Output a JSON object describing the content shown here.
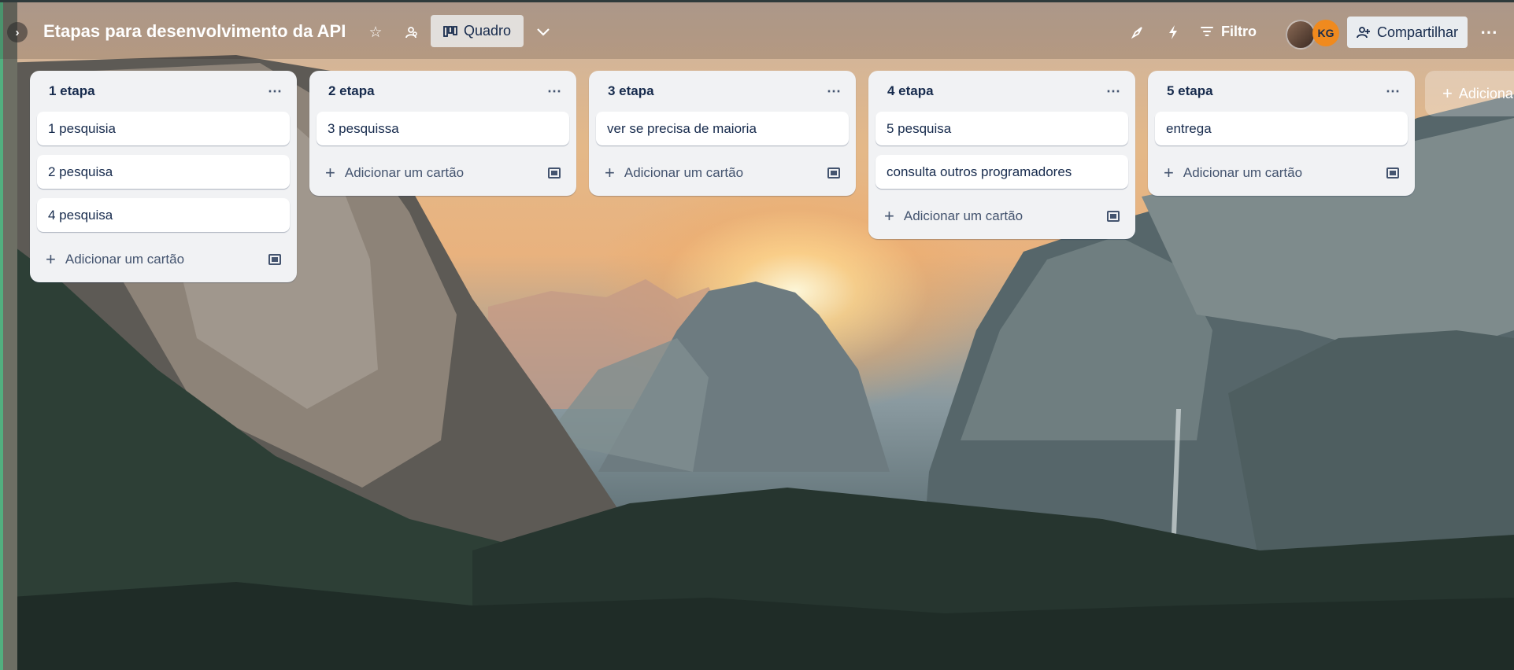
{
  "board": {
    "title": "Etapas para desenvolvimento da API",
    "view_label": "Quadro",
    "filter_label": "Filtro",
    "share_label": "Compartilhar",
    "member_initials": "KG"
  },
  "lists": [
    {
      "title": "1 etapa",
      "cards": [
        "1 pesquisia",
        "2 pesquisa",
        "4 pesquisa"
      ]
    },
    {
      "title": "2 etapa",
      "cards": [
        "3 pesquissa"
      ]
    },
    {
      "title": "3 etapa",
      "cards": [
        "ver se precisa de maioria"
      ]
    },
    {
      "title": "4 etapa",
      "cards": [
        "5 pesquisa",
        "consulta outros programadores"
      ]
    },
    {
      "title": "5 etapa",
      "cards": [
        "entrega"
      ]
    }
  ],
  "add_card_label": "Adicionar um cartão",
  "add_list_label": "Adiciona",
  "icons": {
    "expand": "chevron-right-icon",
    "star": "star-icon",
    "visibility": "workspace-visibility-icon",
    "view": "board-view-icon",
    "view_switch": "chevron-down-icon",
    "power_ups": "rocket-icon",
    "automation": "lightning-icon",
    "filter": "filter-icon",
    "share": "add-person-icon",
    "more": "more-dots-icon",
    "add": "plus-icon",
    "template": "card-template-icon"
  }
}
